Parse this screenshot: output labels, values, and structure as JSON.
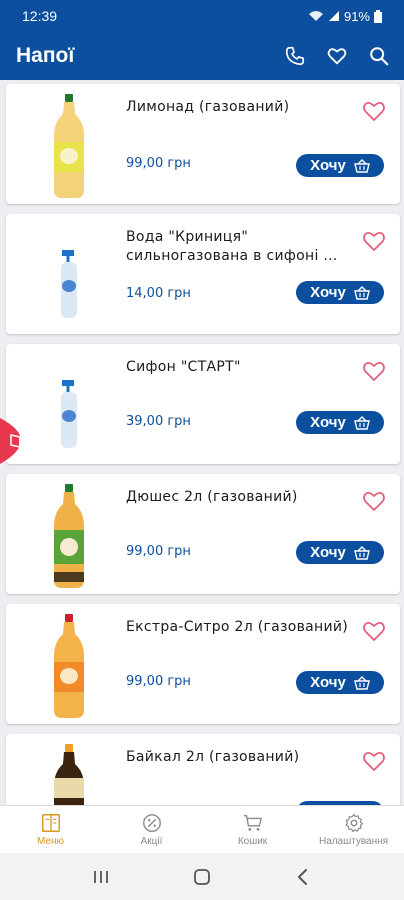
{
  "status": {
    "time": "12:39",
    "battery": "91%"
  },
  "app_bar": {
    "title": "Напої"
  },
  "products": [
    {
      "name": "Лимонад (газований)",
      "price": "99,00 грн",
      "button": "Хочу",
      "bottle": "lemonade"
    },
    {
      "name": "Вода \"Криниця\" сильногазована в сифоні ...",
      "price": "14,00 грн",
      "button": "Хочу",
      "bottle": "siphon"
    },
    {
      "name": "Сифон \"СТАРТ\"",
      "price": "39,00 грн",
      "button": "Хочу",
      "bottle": "siphon"
    },
    {
      "name": "Дюшес 2л (газований)",
      "price": "99,00 грн",
      "button": "Хочу",
      "bottle": "duchess"
    },
    {
      "name": " Екстра-Ситро 2л (газований)",
      "price": "99,00 грн",
      "button": "Хочу",
      "bottle": "citro"
    },
    {
      "name": "Байкал 2л (газований)",
      "price": "",
      "button": "",
      "bottle": "baikal"
    }
  ],
  "bottom_nav": {
    "items": [
      {
        "label": "Меню",
        "icon": "menu-book-icon",
        "active": true
      },
      {
        "label": "Акції",
        "icon": "percent-icon",
        "active": false
      },
      {
        "label": "Кошик",
        "icon": "cart-icon",
        "active": false
      },
      {
        "label": "Налаштування",
        "icon": "gear-icon",
        "active": false
      }
    ]
  },
  "colors": {
    "primary": "#0c4f9e",
    "heart": "#e0607e",
    "active": "#d89a1e",
    "side_tab": "#e8384f"
  }
}
